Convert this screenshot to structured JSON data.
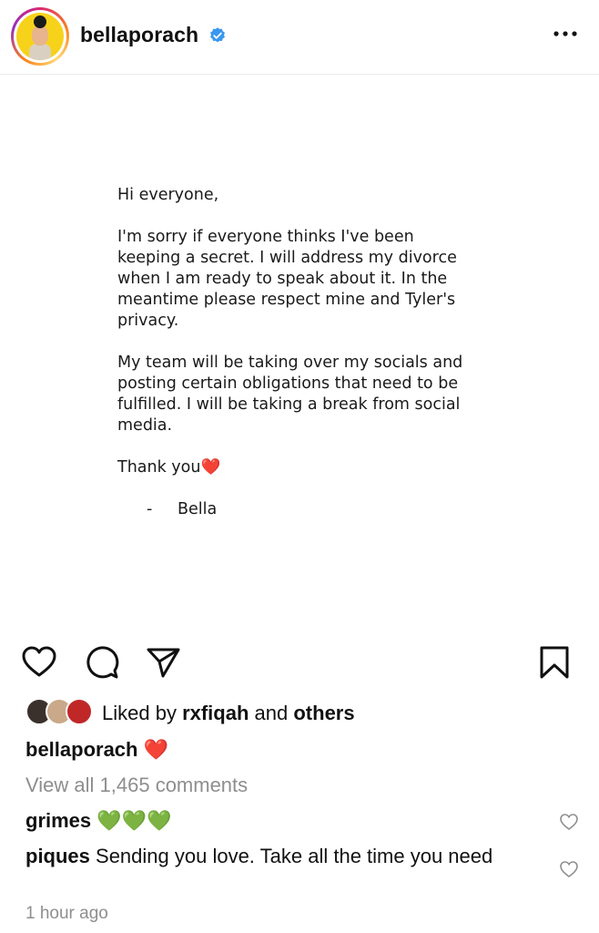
{
  "header": {
    "username": "bellaporach",
    "verified_icon": "verified-badge-icon",
    "more_icon": "more-options-icon"
  },
  "post": {
    "greeting": "Hi everyone,",
    "paragraph1": "I'm sorry if everyone thinks I've been\nkeeping a secret. I will address my divorce\nwhen I am ready to speak about it. In the\nmeantime please respect mine and Tyler's\nprivacy.",
    "paragraph2": "My team will be taking over my socials and\nposting certain obligations that need to be\nfulfilled. I will be taking a break from social\nmedia.",
    "thanks": "Thank you❤️",
    "signature_dash": "-",
    "signature_name": "Bella"
  },
  "actions": {
    "like_icon": "heart-icon",
    "comment_icon": "comment-icon",
    "share_icon": "share-icon",
    "save_icon": "bookmark-icon"
  },
  "likes": {
    "prefix": "Liked by ",
    "user": "rxfiqah",
    "middle": " and ",
    "others": "others"
  },
  "caption": {
    "username": "bellaporach",
    "text": " ❤️"
  },
  "view_all": "View all 1,465 comments",
  "comments": [
    {
      "username": "grimes",
      "text": " 💚💚💚"
    },
    {
      "username": "piques",
      "text": " Sending you love. Take all the time you need"
    }
  ],
  "timestamp": "1 hour ago",
  "colors": {
    "verified": "#3897f0",
    "secondary_text": "#8e8e8e",
    "avatar_bg": "#f7d21a"
  }
}
